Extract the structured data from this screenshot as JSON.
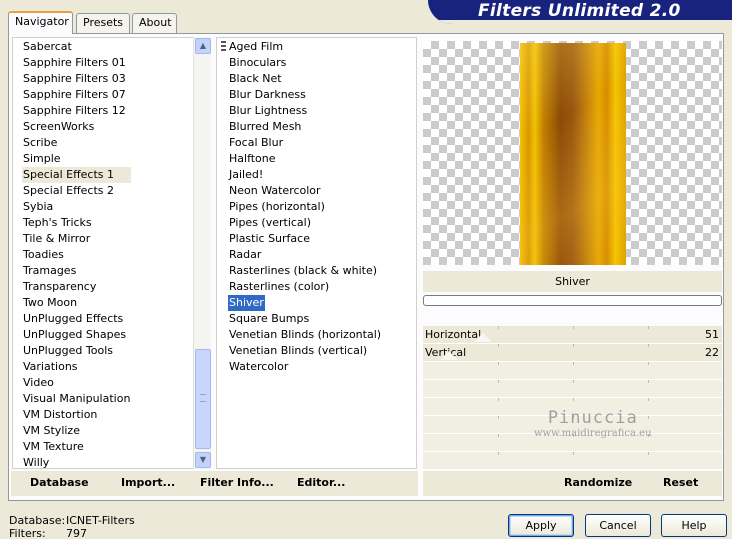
{
  "tabs": [
    "Navigator",
    "Presets",
    "About"
  ],
  "banner_title": "Filters Unlimited 2.0",
  "categories": [
    "Sabercat",
    "Sapphire Filters 01",
    "Sapphire Filters 03",
    "Sapphire Filters 07",
    "Sapphire Filters 12",
    "ScreenWorks",
    "Scribe",
    "Simple",
    "Special Effects 1",
    "Special Effects 2",
    "Sybia",
    "Teph's Tricks",
    "Tile & Mirror",
    "Toadies",
    "Tramages",
    "Transparency",
    "Two Moon",
    "UnPlugged Effects",
    "UnPlugged Shapes",
    "UnPlugged Tools",
    "Variations",
    "Video",
    "Visual Manipulation",
    "VM Distortion",
    "VM Stylize",
    "VM Texture",
    "Willy"
  ],
  "selected_category": "Special Effects 1",
  "filters": [
    "Aged Film",
    "Binoculars",
    "Black Net",
    "Blur Darkness",
    "Blur Lightness",
    "Blurred Mesh",
    "Focal Blur",
    "Halftone",
    "Jailed!",
    "Neon Watercolor",
    "Pipes (horizontal)",
    "Pipes (vertical)",
    "Plastic Surface",
    "Radar",
    "Rasterlines (black & white)",
    "Rasterlines (color)",
    "Shiver",
    "Square Bumps",
    "Venetian Blinds (horizontal)",
    "Venetian Blinds (vertical)",
    "Watercolor"
  ],
  "selected_filter": "Shiver",
  "filter_name": "Shiver",
  "params": [
    {
      "label": "Horizontal",
      "value": "51",
      "level": 51
    },
    {
      "label": "Vertical",
      "value": "22",
      "level": 22
    }
  ],
  "watermark": {
    "name": "Pinuccia",
    "url": "www.maidiregrafica.eu"
  },
  "toolbar_left": [
    "Database",
    "Import...",
    "Filter Info...",
    "Editor..."
  ],
  "toolbar_right": [
    "Randomize",
    "Reset"
  ],
  "status": {
    "database_label": "Database:",
    "database_value": "ICNET-Filters",
    "filters_label": "Filters:",
    "filters_value": "797"
  },
  "buttons": {
    "apply": "Apply",
    "cancel": "Cancel",
    "help": "Help"
  },
  "colors": {
    "selection": "#316ac5",
    "banner": "#17237d",
    "face": "#ece9d8"
  }
}
